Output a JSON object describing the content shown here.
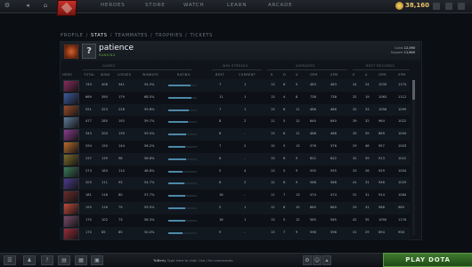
{
  "topbar": {
    "nav": [
      "HEROES",
      "STORE",
      "WATCH",
      "LEARN",
      "ARCADE"
    ],
    "gold": "38,160"
  },
  "subnav": [
    "PROFILE",
    "/",
    "STATS",
    "/",
    "TEAMMATES",
    "/",
    "TROPHIES",
    "/",
    "TICKETS"
  ],
  "profile": {
    "name": "patience",
    "subtitle": "RANKING",
    "coins_label": "Coins",
    "coins_value": "12,090",
    "support_label": "Support",
    "support_value": "11,640"
  },
  "groups": {
    "games": "GAMES",
    "win_streaks": "WIN STREAKS",
    "averages": "AVERAGES",
    "best_records": "BEST RECORDS"
  },
  "columns": {
    "hero": "HERO",
    "total": "TOTAL",
    "wins": "WINS",
    "losses": "LOSSES",
    "winrate": "WINRATE",
    "rating": "RATING",
    "best": "BEST",
    "current": "CURRENT",
    "k": "K",
    "d": "D",
    "a": "A",
    "gpm": "GPM",
    "xpm": "XPM",
    "bk": "K",
    "ba": "A",
    "bgpm": "GPM",
    "bxpm": "XPM"
  },
  "rows": [
    {
      "total": "749",
      "wins": "408",
      "losses": "341",
      "winrate": "54.5%",
      "rating": 0.78,
      "best": "7",
      "current": "1",
      "k": "13",
      "d": "6",
      "a": "9",
      "gpm": "483",
      "xpm": "483",
      "bk": "24",
      "ba": "24",
      "bgpm": "1035",
      "bxpm": "1174",
      "color": "#8a2b5c"
    },
    {
      "total": "669",
      "wins": "390",
      "losses": "179",
      "winrate": "68.5%",
      "rating": 0.82,
      "best": "11",
      "current": "1",
      "k": "13",
      "d": "4",
      "a": "8",
      "gpm": "738",
      "xpm": "738",
      "bk": "32",
      "ba": "19",
      "bgpm": "1063",
      "bxpm": "1112",
      "color": "#3a5a9e"
    },
    {
      "total": "551",
      "wins": "323",
      "losses": "228",
      "winrate": "59.8%",
      "rating": 0.72,
      "best": "7",
      "current": "1",
      "k": "13",
      "d": "6",
      "a": "11",
      "gpm": "486",
      "xpm": "486",
      "bk": "32",
      "ba": "33",
      "bgpm": "1056",
      "bxpm": "1099",
      "color": "#9a4a2a"
    },
    {
      "total": "477",
      "wins": "285",
      "losses": "192",
      "winrate": "59.7%",
      "rating": 0.68,
      "best": "8",
      "current": "2",
      "k": "11",
      "d": "5",
      "a": "12",
      "gpm": "640",
      "xpm": "640",
      "bk": "39",
      "ba": "32",
      "bgpm": "964",
      "bxpm": "1022",
      "color": "#5d7a9a"
    },
    {
      "total": "343",
      "wins": "204",
      "losses": "139",
      "winrate": "59.5%",
      "rating": 0.64,
      "best": "8",
      "current": "-",
      "k": "13",
      "d": "6",
      "a": "11",
      "gpm": "488",
      "xpm": "488",
      "bk": "35",
      "ba": "39",
      "bgpm": "869",
      "bxpm": "1004",
      "color": "#8a3a8e"
    },
    {
      "total": "294",
      "wins": "150",
      "losses": "144",
      "winrate": "56.2%",
      "rating": 0.6,
      "best": "7",
      "current": "2",
      "k": "10",
      "d": "5",
      "a": "13",
      "gpm": "376",
      "xpm": "376",
      "bk": "29",
      "ba": "46",
      "bgpm": "957",
      "bxpm": "1003",
      "color": "#b86a2a"
    },
    {
      "total": "237",
      "wins": "139",
      "losses": "98",
      "winrate": "58.6%",
      "rating": 0.62,
      "best": "6",
      "current": "-",
      "k": "13",
      "d": "6",
      "a": "9",
      "gpm": "622",
      "xpm": "622",
      "bk": "32",
      "ba": "39",
      "bgpm": "913",
      "bxpm": "1022",
      "color": "#7a6a2a"
    },
    {
      "total": "273",
      "wins": "163",
      "losses": "110",
      "winrate": "48.8%",
      "rating": 0.5,
      "best": "5",
      "current": "4",
      "k": "13",
      "d": "5",
      "a": "9",
      "gpm": "595",
      "xpm": "595",
      "bk": "33",
      "ba": "26",
      "bgpm": "929",
      "bxpm": "1004",
      "color": "#3a7a5a"
    },
    {
      "total": "205",
      "wins": "111",
      "losses": "93",
      "winrate": "54.7%",
      "rating": 0.56,
      "best": "6",
      "current": "2",
      "k": "12",
      "d": "6",
      "a": "9",
      "gpm": "568",
      "xpm": "568",
      "bk": "41",
      "ba": "31",
      "bgpm": "946",
      "bxpm": "1029",
      "color": "#4a3a8e"
    },
    {
      "total": "181",
      "wins": "116",
      "losses": "80",
      "winrate": "57.7%",
      "rating": 0.58,
      "best": "16",
      "current": "-",
      "k": "11",
      "d": "7",
      "a": "13",
      "gpm": "474",
      "xpm": "474",
      "bk": "31",
      "ba": "31",
      "bgpm": "914",
      "bxpm": "1084",
      "color": "#6a2a2a"
    },
    {
      "total": "195",
      "wins": "116",
      "losses": "79",
      "winrate": "59.5%",
      "rating": 0.6,
      "best": "5",
      "current": "1",
      "k": "12",
      "d": "6",
      "a": "10",
      "gpm": "660",
      "xpm": "660",
      "bk": "29",
      "ba": "31",
      "bgpm": "968",
      "bxpm": "989",
      "color": "#c04a3a"
    },
    {
      "total": "170",
      "wins": "102",
      "losses": "73",
      "winrate": "58.3%",
      "rating": 0.6,
      "best": "16",
      "current": "1",
      "k": "13",
      "d": "5",
      "a": "12",
      "gpm": "565",
      "xpm": "565",
      "bk": "42",
      "ba": "35",
      "bgpm": "1090",
      "bxpm": "1176",
      "color": "#7a4a6a"
    },
    {
      "total": "170",
      "wins": "85",
      "losses": "85",
      "winrate": "50.0%",
      "rating": 0.5,
      "best": "9",
      "current": "-",
      "k": "13",
      "d": "7",
      "a": "9",
      "gpm": "596",
      "xpm": "596",
      "bk": "31",
      "ba": "29",
      "bgpm": "894",
      "bxpm": "958",
      "color": "#9a2a3a"
    }
  ],
  "bottombar": {
    "chat_name": "TsiBerly",
    "chat_text": "Type here to chat. Use / for commands.",
    "play": "PLAY DOTA"
  }
}
